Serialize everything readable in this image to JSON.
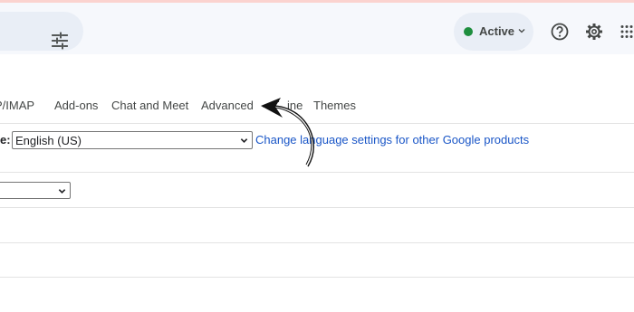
{
  "header": {
    "status": {
      "label": "Active",
      "color": "#1e8e3e"
    },
    "icons": [
      "search-options-icon",
      "help-icon",
      "gear-icon",
      "apps-icon"
    ]
  },
  "tabs": [
    {
      "label": "P/IMAP"
    },
    {
      "label": "Add-ons"
    },
    {
      "label": "Chat and Meet"
    },
    {
      "label": "Advanced"
    },
    {
      "label": "ine"
    },
    {
      "label": "Themes"
    }
  ],
  "settings": {
    "language_label_fragment": "e:",
    "language_value": "English (US)",
    "language_link": "Change language settings for other Google products",
    "second_select_value": ""
  },
  "colors": {
    "header_bg": "#f6f8fc",
    "pill_bg": "#e9eef6",
    "link": "#1a56c7"
  }
}
